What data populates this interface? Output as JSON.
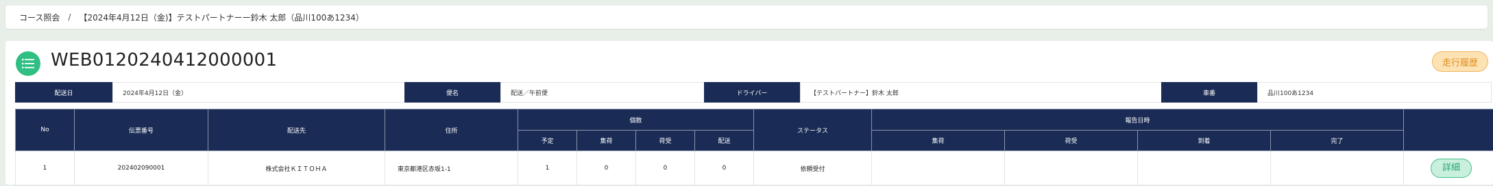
{
  "breadcrumb": {
    "root": "コース照会",
    "separator": "/",
    "current": "【2024年4月12日（金)】テストパートナーー鈴木 太郎（品川100あ1234）"
  },
  "header": {
    "title": "WEB0120240412000001",
    "history_button": "走行履歴"
  },
  "info": {
    "delivery_date_label": "配送日",
    "delivery_date_value": "2024年4月12日（金）",
    "course_name_label": "便名",
    "course_name_value": "配送／午前便",
    "driver_label": "ドライバー",
    "driver_value": "【テストパートナー】鈴木 太郎",
    "vehicle_label": "車番",
    "vehicle_value": "品川100あ1234"
  },
  "table": {
    "headers": {
      "no": "No",
      "slip_number": "伝票番号",
      "destination": "配送先",
      "address": "住所",
      "quantity_group": "個数",
      "quantity_sub": [
        "予定",
        "集荷",
        "荷受",
        "配送"
      ],
      "status": "ステータス",
      "report_group": "報告日時",
      "report_sub": [
        "集荷",
        "荷受",
        "到着",
        "完了"
      ]
    },
    "rows": [
      {
        "no": "1",
        "slip_number": "202402090001",
        "destination": "株式会社ＫＩＴＯＨＡ",
        "address": "東京都港区赤坂1-1",
        "planned": "1",
        "pickup": "0",
        "received": "0",
        "delivered": "0",
        "status": "依頼受付",
        "report_pickup": "",
        "report_received": "",
        "report_arrival": "",
        "report_complete": "",
        "detail_label": "詳細"
      }
    ]
  },
  "colors": {
    "navy": "#1a2b55",
    "accent_green": "#2fbf82",
    "history_orange": "#f3b35a"
  }
}
